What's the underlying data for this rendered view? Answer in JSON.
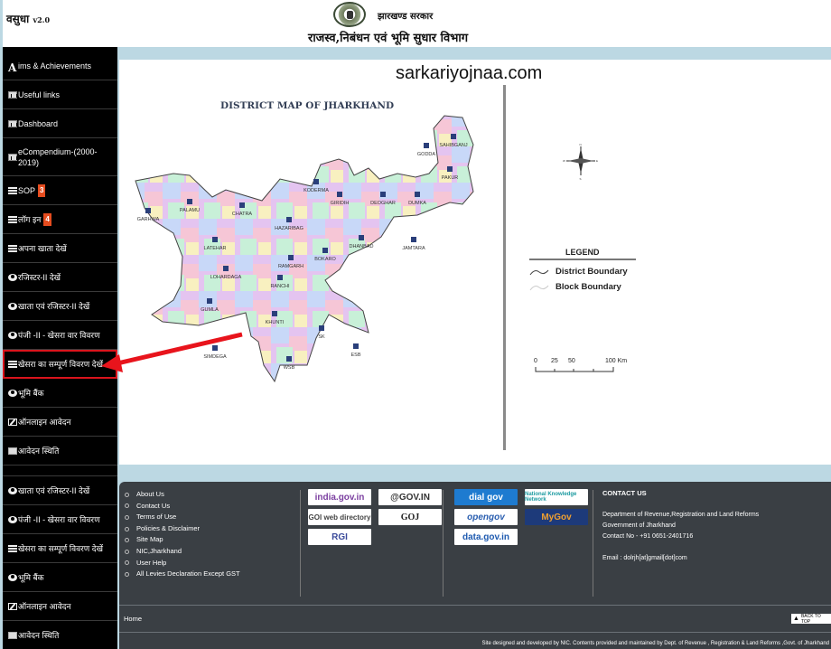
{
  "header": {
    "brand": "वसुधा",
    "version": "v2.0",
    "gov_name": "झारखण्ड सरकार",
    "department_title": "राजस्व,निबंधन एवं भूमि सुधार विभाग"
  },
  "sidebar": {
    "items": [
      {
        "icon": "letter-a-icon",
        "label": "ims & Achievements",
        "prefix": "A"
      },
      {
        "icon": "bar-chart-icon",
        "label": "Useful links"
      },
      {
        "icon": "bar-chart-icon",
        "label": "Dashboard"
      },
      {
        "icon": "bar-chart-icon",
        "label": "eCompendium-(2000-2019)"
      },
      {
        "icon": "list-icon",
        "label": "SOP",
        "badge": "3"
      },
      {
        "icon": "list-icon",
        "label": "लॉग इन",
        "badge": "4"
      },
      {
        "icon": "list-icon",
        "label": "अपना खाता देखें"
      },
      {
        "icon": "eye-icon",
        "label": "रजिस्टर-II देखें"
      },
      {
        "icon": "eye-icon",
        "label": "खाता एवं रजिस्टर-II देखें"
      },
      {
        "icon": "eye-icon",
        "label": "पंजी -II - खेसरा वार विवरण"
      },
      {
        "icon": "list-icon",
        "label": "खेसरा का सम्पूर्ण विवरण देखें",
        "highlighted": true
      },
      {
        "icon": "eye-icon",
        "label": "भूमि बैंक"
      },
      {
        "icon": "edit-icon",
        "label": "ऑनलाइन आवेदन"
      },
      {
        "icon": "card-icon",
        "label": "आवेदन स्थिति"
      },
      {
        "icon": "none",
        "label": ""
      },
      {
        "icon": "eye-icon",
        "label": "खाता एवं रजिस्टर-II देखें"
      },
      {
        "icon": "eye-icon",
        "label": "पंजी -II - खेसरा वार विवरण"
      },
      {
        "icon": "list-icon",
        "label": "खेसरा का सम्पूर्ण विवरण देखें"
      },
      {
        "icon": "eye-icon",
        "label": "भूमि बैंक"
      },
      {
        "icon": "edit-icon",
        "label": "ऑनलाइन आवेदन"
      },
      {
        "icon": "card-icon",
        "label": "आवेदन स्थिति"
      }
    ]
  },
  "main": {
    "watermark": "sarkariyojnaa.com",
    "map_title": "DISTRICT MAP OF JHARKHAND",
    "districts": [
      "SAHIBGANJ",
      "GODDA",
      "PAKUR",
      "KODERMA",
      "GIRIDIH",
      "DEOGHAR",
      "DUMKA",
      "GARHWA",
      "PALAMU",
      "CHATRA",
      "HAZARIBAG",
      "JAMTARA",
      "DHANBAD",
      "LATEHAR",
      "BOKARO",
      "RAMGARH",
      "LOHARDAGA",
      "RANCHI",
      "GUMLA",
      "KHUNTI",
      "SK",
      "SIMDEGA",
      "WSB",
      "ESB"
    ],
    "compass": {
      "n": "N",
      "s": "S",
      "e": "E",
      "w": "W"
    },
    "legend": {
      "title": "LEGEND",
      "items": [
        "District Boundary",
        "Block Boundary"
      ]
    },
    "scale": {
      "labels": [
        "0",
        "25",
        "50",
        "100 Km"
      ]
    }
  },
  "footer": {
    "links": [
      "About Us",
      "Contact Us",
      "Terms of Use",
      "Policies & Disclaimer",
      "Site Map",
      "NIC,Jharkhand",
      "User Help",
      "All Levies Declaration Except GST"
    ],
    "logos": [
      "india.gov.in",
      "@GOV.IN",
      "GOI web directory",
      "GOJ",
      "RGI",
      "dial gov",
      "National Knowledge Network",
      "opengov",
      "MyGov",
      "data.gov.in"
    ],
    "contact": {
      "heading": "CONTACT US",
      "dept": "Department of Revenue,Registration and Land Reforms",
      "gov": "Government of Jharkhand",
      "phone": "Contact No - +91 0651-2401716",
      "email": "Email : dolrjh[at]gmail[dot]com"
    },
    "home": "Home",
    "back_to_top": "BACK TO TOP",
    "credit": "Site designed and developed by NIC. Contents provided and maintained by Dept. of Revenue , Registration & Land Reforms ,Govt. of Jharkhand"
  },
  "colors": {
    "sidebar_bg": "#000000",
    "page_bg": "#bcd8e3",
    "footer_bg": "#3a3f44",
    "highlight": "#d9141c",
    "badge": "#e54c1f"
  }
}
